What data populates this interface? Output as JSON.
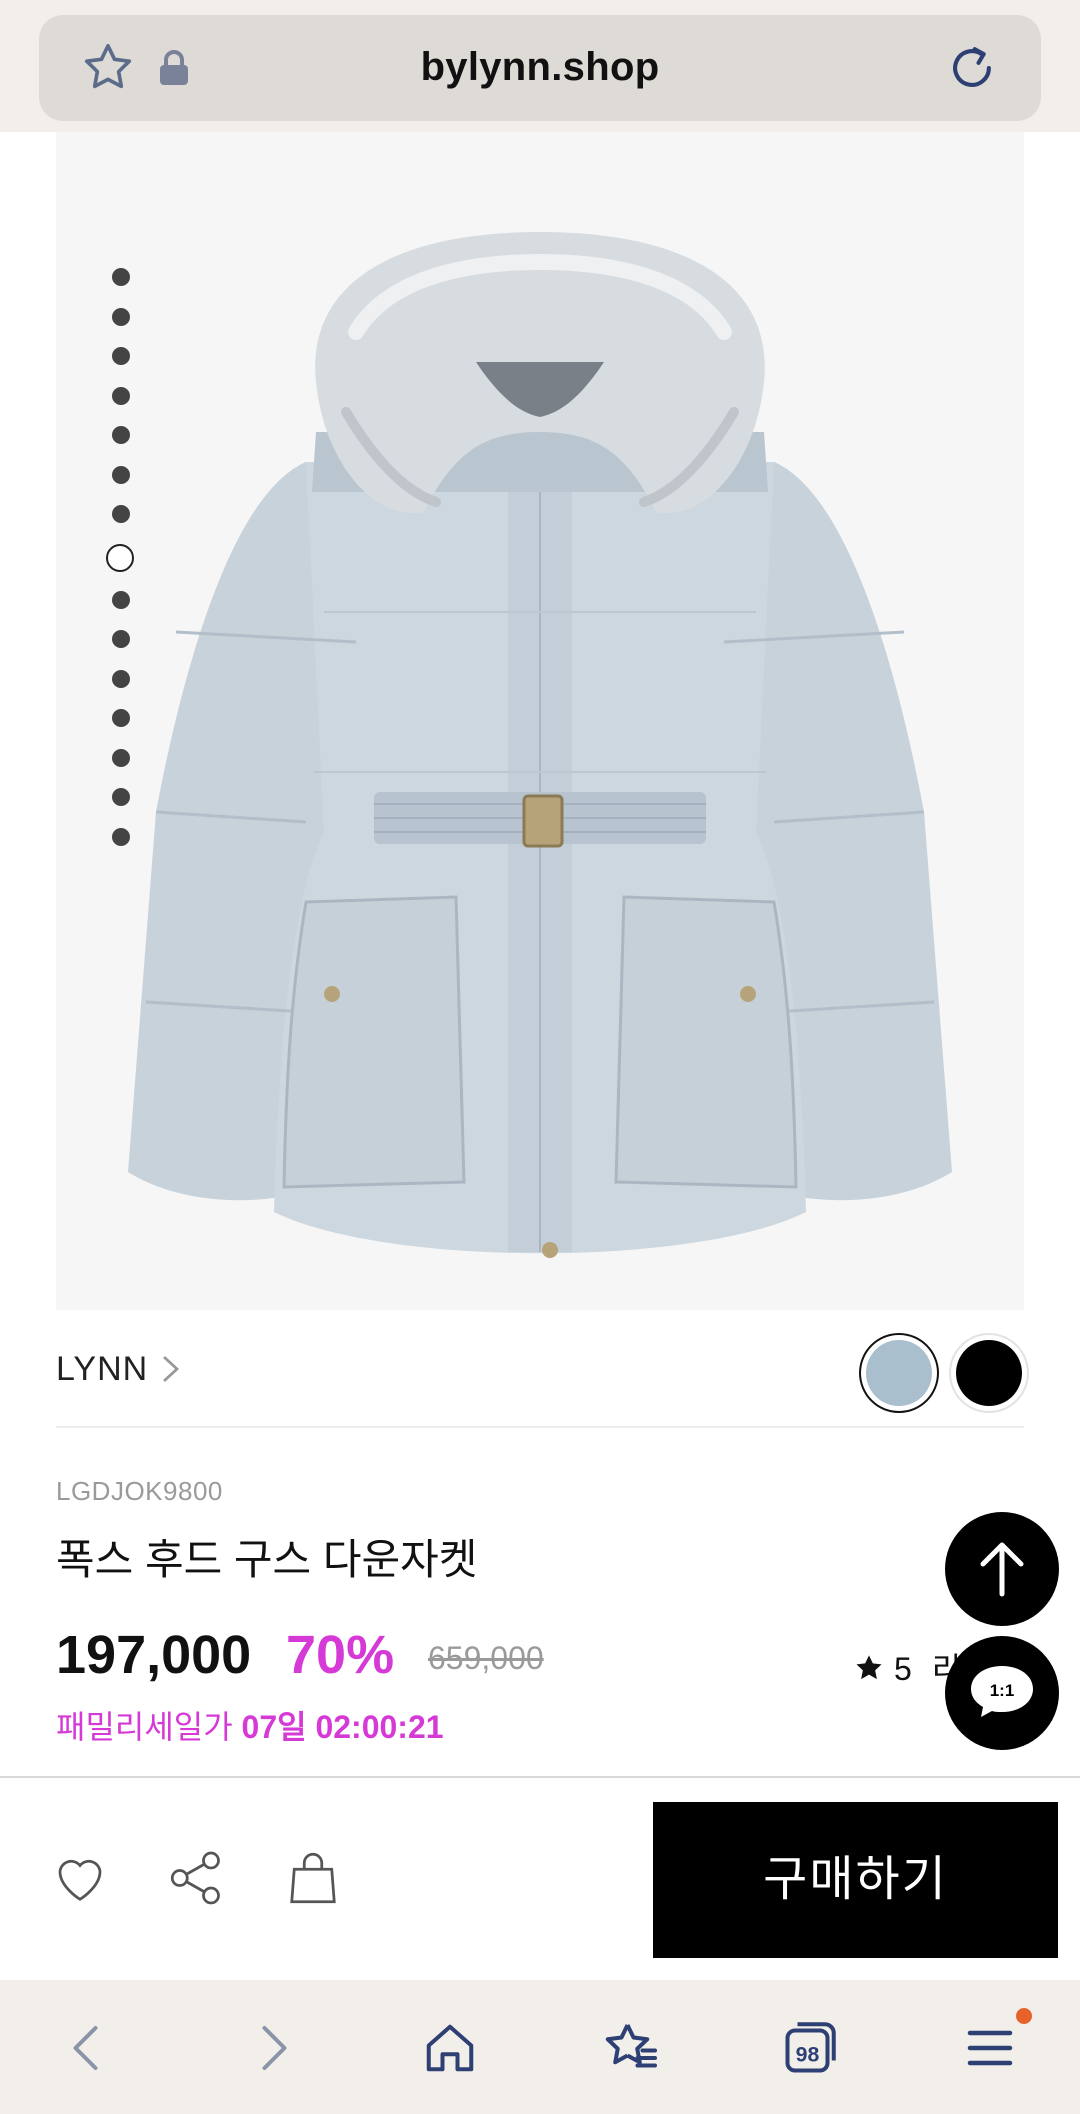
{
  "browser": {
    "url": "bylynn.shop",
    "tab_count": "98"
  },
  "gallery": {
    "dot_count": 15,
    "active_index": 7
  },
  "product": {
    "brand": "LYNN",
    "colors": [
      {
        "name": "light blue",
        "hex": "#a9bfcd",
        "selected": true
      },
      {
        "name": "black",
        "hex": "#000000",
        "selected": false
      }
    ],
    "code": "LGDJOK9800",
    "title": "폭스 후드 구스 다운자켓",
    "price": "197,000",
    "discount": "70%",
    "original_price": "659,000",
    "sale_label": "패밀리세일가",
    "sale_timer": "07일 02:00:21",
    "rating": "5",
    "rating_tail": "리"
  },
  "fab": {
    "chat_label": "1:1"
  },
  "actions": {
    "buy_label": "구매하기"
  },
  "colors": {
    "accent": "#d63ad6",
    "notification": "#e5632a"
  }
}
